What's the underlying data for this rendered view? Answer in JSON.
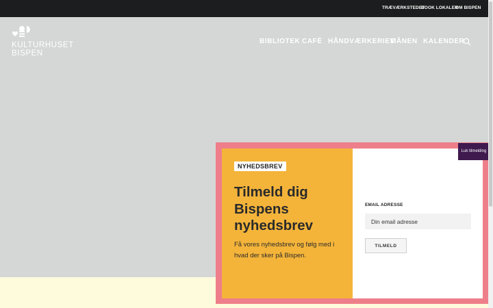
{
  "topbar": {
    "links": [
      "TRÆVÆRKSTEDET",
      "BOOK LOKALER",
      "OM BISPEN"
    ]
  },
  "logo": {
    "line1": "KULTURHUSET",
    "line2": "BISPEN"
  },
  "nav": {
    "items": [
      "BIBLIOTEK",
      "CAFÉ",
      "HÅNDVÆRKERIET",
      "MÅNEN",
      "KALENDER"
    ],
    "search_icon": "search-icon"
  },
  "newsletter": {
    "badge": "NYHEDSBREV",
    "title": "Tilmeld dig Bispens nyhedsbrev",
    "description": "Få vores nyhedsbrev og følg med i hvad der sker på Bispen.",
    "email_label": "EMAIL ADRESSE",
    "email_placeholder": "Din email adresse",
    "email_value": "",
    "submit_label": "TILMELD",
    "close_label": "Luk tilmelding"
  },
  "colors": {
    "topbar": "#1c1d1e",
    "hero": "#d5d6d6",
    "modal_border": "#ee7f8a",
    "modal_left": "#f4b43a",
    "close_tab": "#3e1a4f",
    "cream": "#fdfbdc"
  }
}
